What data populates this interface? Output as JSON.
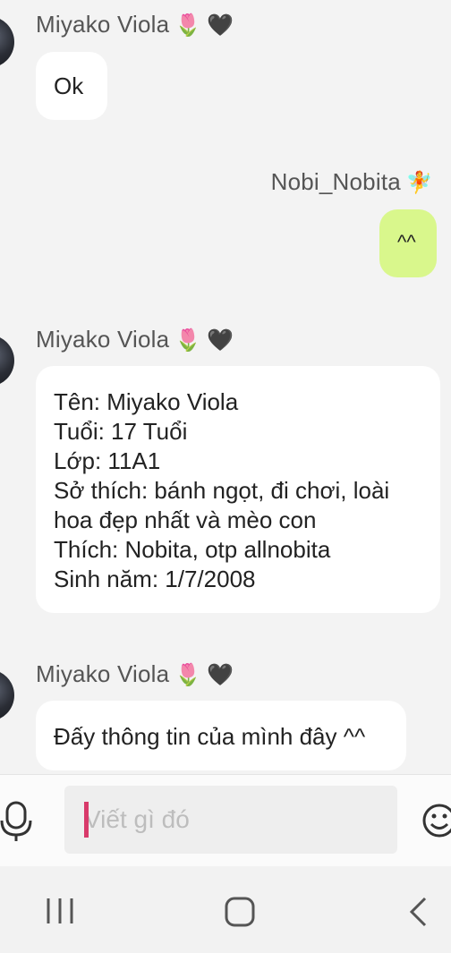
{
  "messages": [
    {
      "sender": "Miyako Viola",
      "sender_emoji": [
        "🌷",
        "🖤"
      ],
      "text": "Ok"
    },
    {
      "sender": "Nobi_Nobita",
      "sender_emoji": [
        "🧚"
      ],
      "text": "^^"
    },
    {
      "sender": "Miyako Viola",
      "sender_emoji": [
        "🌷",
        "🖤"
      ],
      "lines": [
        "Tên: Miyako Viola",
        "Tuổi: 17 Tuổi",
        "Lớp: 11A1",
        "Sở thích: bánh ngọt, đi chơi, loài",
        "hoa đẹp nhất và mèo con",
        "Thích: Nobita, otp allnobita",
        "Sinh năm: 1/7/2008"
      ]
    },
    {
      "sender": "Miyako Viola",
      "sender_emoji": [
        "🌷",
        "🖤"
      ],
      "text": "Đấy thông tin của mình đây ^^"
    }
  ],
  "composer": {
    "placeholder": "Viết gì đó"
  },
  "icons": {
    "mic": "microphone-icon",
    "emoji": "smiley-icon",
    "nav_recent": "recent-apps-icon",
    "nav_home": "home-icon",
    "nav_back": "back-icon"
  },
  "colors": {
    "background": "#f3f3f3",
    "incoming_bubble": "#ffffff",
    "outgoing_bubble": "#d9f78c",
    "caret": "#d83a6a"
  }
}
